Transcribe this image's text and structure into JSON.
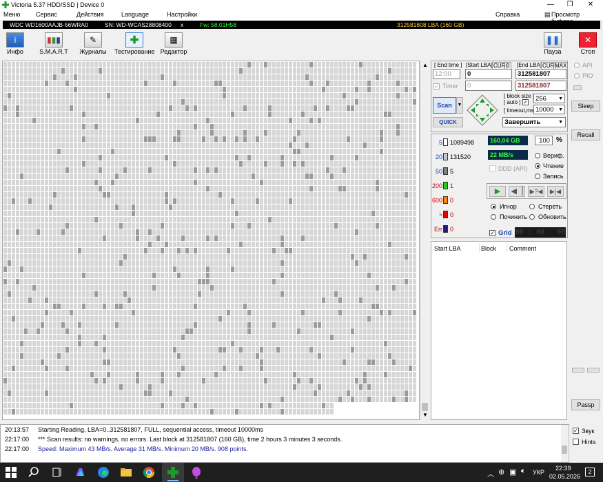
{
  "window": {
    "title": "Victoria 5.37 HDD/SSD | Device 0"
  },
  "menu": [
    "Меню",
    "Сервис",
    "Действия",
    "Language",
    "Настройки"
  ],
  "menu_right": {
    "help": "Справка",
    "buffer_view": "Просмотр буфера"
  },
  "drive": {
    "model": "WDC WD1600AAJB-56WRA0",
    "serial": "SN: WD-WCAS28808400",
    "close": "x",
    "firmware": "Fw: 58.01H58",
    "capacity": "312581808 LBA (160 GB)"
  },
  "toolbar": {
    "info": "Инфо",
    "smart": "S.M.A.R.T",
    "logs": "Журналы",
    "testing": "Тестирование",
    "editor": "Редактор",
    "pause": "Пауза",
    "stop": "Стоп"
  },
  "scan": {
    "end_time_label": "[ End time ]",
    "start_lba_label": "[Start LBA]",
    "cur_label": "CUR",
    "zero_label": "0",
    "end_lba_label": "[End LBA]",
    "cur2_label": "CUR",
    "max_label": "MAX",
    "end_time_value": "12:00",
    "start_lba_value": "0",
    "end_lba_value": "312581807",
    "timer_label": "Timer",
    "timer_value": "0",
    "end_lba_value2": "312581807",
    "block_size_label": "[ block size ]",
    "auto_label": "[ auto ]",
    "block_size_value": "256",
    "timeout_label": "[ timeout,ms ]",
    "timeout_value": "10000",
    "scan_btn": "Scan",
    "quick_btn": "QUICK",
    "finish_select": "Завершить"
  },
  "side": {
    "api": "API",
    "pio": "PIO",
    "sleep": "Sleep",
    "recall": "Recall",
    "passp": "Passp"
  },
  "stats": {
    "rows": [
      {
        "label": "5",
        "count": "1089498",
        "color": "#ffffff"
      },
      {
        "label": "20",
        "count": "131520",
        "color": "#c8c8c8"
      },
      {
        "label": "50",
        "count": "5",
        "color": "#808080"
      },
      {
        "label": "200",
        "count": "1",
        "color": "#22cc22"
      },
      {
        "label": "600",
        "count": "0",
        "color": "#ff8800"
      },
      {
        "label": ">",
        "count": "0",
        "color": "#ee0000"
      },
      {
        "label": "Err",
        "count": "0",
        "color": "#1a1a80"
      }
    ],
    "size": "160,04 GB",
    "speed": "22 MB/s",
    "percent": "100",
    "percent_sign": "%",
    "ddd_api": "DDD (API)",
    "verify": "Вериф.",
    "read": "Чтение",
    "write": "Запись",
    "ignore": "Игнор",
    "erase": "Стереть",
    "repair": "Починить",
    "refresh": "Обновить",
    "grid": "Grid",
    "clock": "00 : 00 : 00"
  },
  "table": {
    "headers": [
      "Start LBA",
      "Block",
      "Comment"
    ]
  },
  "log": [
    {
      "time": "20:13:57",
      "text": "Starting Reading, LBA=0..312581807, FULL, sequential access, timeout 10000ms",
      "color": "#000000"
    },
    {
      "time": "22:17:00",
      "text": "*** Scan results: no warnings, no errors. Last block at 312581807 (160 GB), time 2 hours 3 minutes 3 seconds.",
      "color": "#000000"
    },
    {
      "time": "22:17:00",
      "text": "Speed: Maximum 43 MB/s. Average 31 MB/s. Minimum 20 MB/s. 908 points.",
      "color": "#1a1aa0"
    }
  ],
  "log_opts": {
    "sound": "Звук",
    "hints": "Hints"
  },
  "taskbar": {
    "lang": "УКР",
    "time": "22:39",
    "date": "02.05.2026",
    "notif": "2"
  }
}
